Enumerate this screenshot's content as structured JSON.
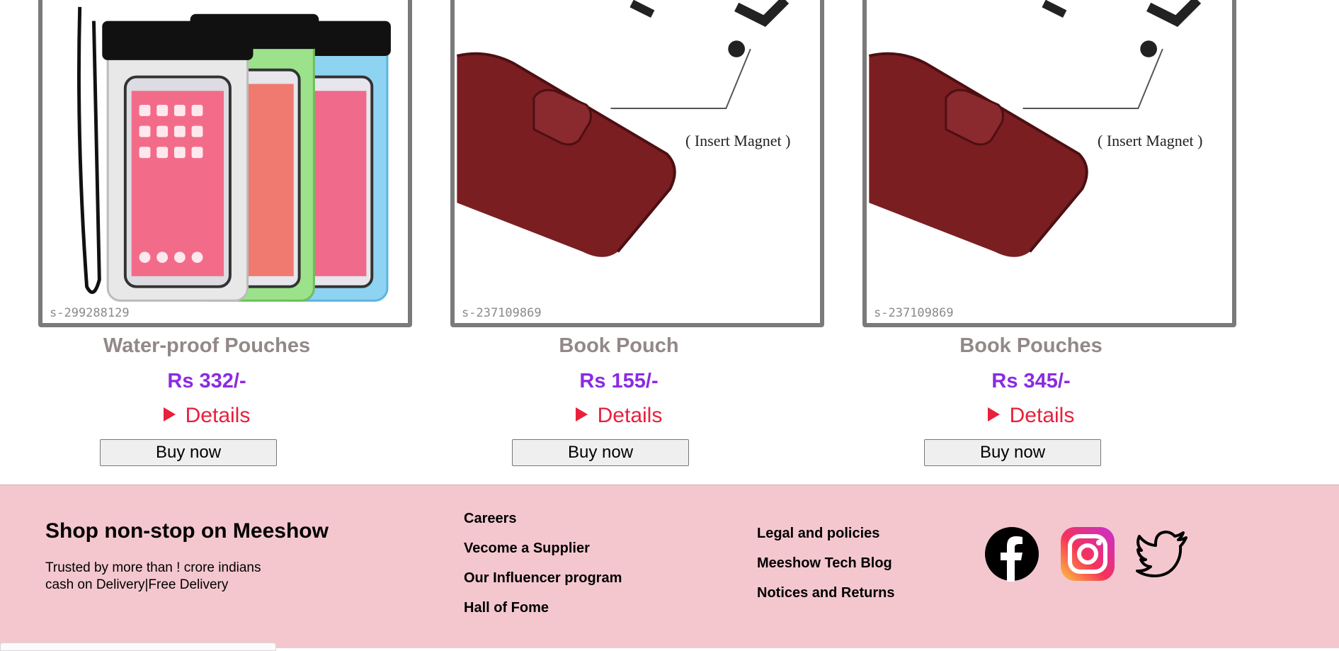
{
  "products": [
    {
      "title": "Water-proof Pouches",
      "price": "Rs 332/-",
      "sku": "s-299288129",
      "details_label": "Details",
      "buy_label": "Buy now"
    },
    {
      "title": "Book Pouch",
      "price": "Rs 155/-",
      "sku": "s-237109869",
      "details_label": "Details",
      "buy_label": "Buy now",
      "image_caption": "( Insert Magnet )"
    },
    {
      "title": "Book Pouches",
      "price": "Rs 345/-",
      "sku": "s-237109869",
      "details_label": "Details",
      "buy_label": "Buy now",
      "image_caption": "( Insert Magnet )"
    }
  ],
  "footer": {
    "heading": "Shop non-stop on Meeshow",
    "tagline_1": "Trusted by more than ! crore indians",
    "tagline_2": "cash on Delivery|Free Delivery",
    "links_col1": [
      "Careers",
      "Vecome a Supplier",
      "Our Influencer program",
      "Hall of Fome"
    ],
    "links_col2": [
      "Legal and policies",
      "Meeshow Tech Blog",
      "Notices and Returns"
    ],
    "social_icons": [
      "facebook-icon",
      "instagram-icon",
      "twitter-icon"
    ]
  },
  "colors": {
    "title": "#938888",
    "price": "#8a2be2",
    "details": "#e8203c",
    "footer_bg": "#f4c7cf",
    "card_border": "#7a7a7a"
  }
}
